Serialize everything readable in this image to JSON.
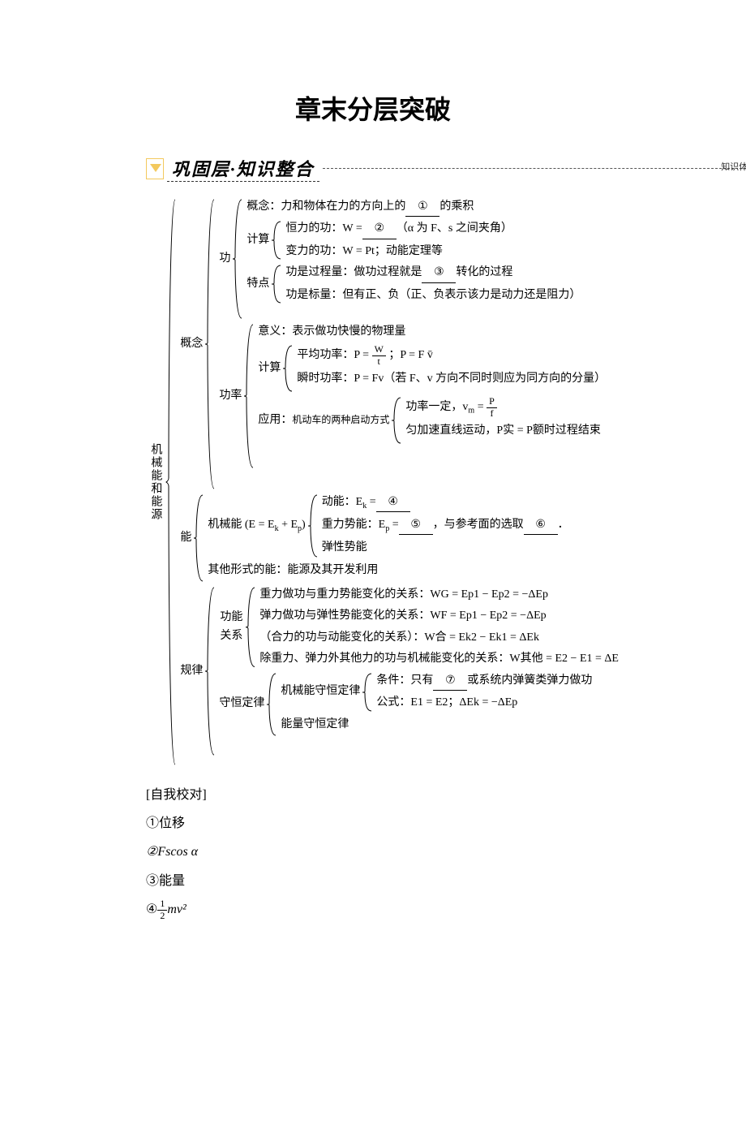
{
  "title": "章末分层突破",
  "banner": {
    "label": "巩固层·知识整合",
    "right": "知识体系  反哺教材"
  },
  "outline": {
    "root_label": "机械能和能源",
    "concept_label": "概念",
    "gong": {
      "label": "功",
      "concept": {
        "prefix": "概念：力和物体在力的方向上的",
        "blank": "①",
        "suffix": "的乘积"
      },
      "calc_label": "计算",
      "calc_const": {
        "prefix": "恒力的功：W =",
        "blank": "②",
        "suffix": "（α 为 F、s 之间夹角）"
      },
      "calc_var": "变力的功：W = Pt；动能定理等",
      "feat_label": "特点",
      "feat_process": {
        "prefix": "功是过程量：做功过程就是",
        "blank": "③",
        "suffix": "转化的过程"
      },
      "feat_scalar": "功是标量：但有正、负（正、负表示该力是动力还是阻力）"
    },
    "power": {
      "label": "功率",
      "meaning": "意义：表示做功快慢的物理量",
      "calc_label": "计算",
      "avg_prefix": "平均功率：P =",
      "avg_frac_num": "W",
      "avg_frac_den": "t",
      "avg_suffix": "；P = F v̄",
      "inst": "瞬时功率：P = Fv（若 F、v 方向不同时则应为同方向的分量）",
      "app_label": "应用：",
      "app_sub": "机动车的两种启动方式",
      "app_line1_prefix": "功率一定，v",
      "app_line1_sub": "m",
      "app_line1_mid": " = ",
      "app_line1_num": "P",
      "app_line1_den": "f",
      "app_line2": "匀加速直线运动，P实 = P额时过程结束"
    },
    "energy": {
      "label": "能",
      "mech_label": "机械能 (E = E",
      "mech_sub1": "k",
      "mech_mid": " + E",
      "mech_sub2": "p",
      "mech_close": ")",
      "kinetic_prefix": "动能：E",
      "kinetic_sub": "k",
      "kinetic_mid": " =",
      "kinetic_blank": "④",
      "grav_prefix": "重力势能：E",
      "grav_sub": "p",
      "grav_mid": " =",
      "grav_blank1": "⑤",
      "grav_after": "，与参考面的选取",
      "grav_blank2": "⑥",
      "grav_tail": "．",
      "elastic": "弹性势能",
      "other": "其他形式的能：能源及其开发利用"
    },
    "law": {
      "label": "规律",
      "rel_label": "功能关系",
      "rel1": "重力做功与重力势能变化的关系：WG = Ep1 − Ep2 = −ΔEp",
      "rel2": "弹力做功与弹性势能变化的关系：WF = Ep1 − Ep2 = −ΔEp",
      "rel3": "（合力的功与动能变化的关系）：W合 = Ek2 − Ek1 = ΔEk",
      "rel4": "除重力、弹力外其他力的功与机械能变化的关系：W其他 = E2 − E1 = ΔE",
      "cons_label": "守恒定律",
      "mech_cons_label": "机械能守恒定律",
      "cond_prefix": "条件：只有",
      "cond_blank": "⑦",
      "cond_suffix": "或系统内弹簧类弹力做功",
      "formula": "公式：E1 = E2；ΔEk = −ΔEp",
      "energy_cons": "能量守恒定律"
    }
  },
  "answers": {
    "heading": "[自我校对]",
    "a1": "①位移",
    "a2": "②Fscos α",
    "a3": "③能量",
    "a4_prefix": "④",
    "a4_num": "1",
    "a4_den": "2",
    "a4_suffix": "mv²"
  }
}
